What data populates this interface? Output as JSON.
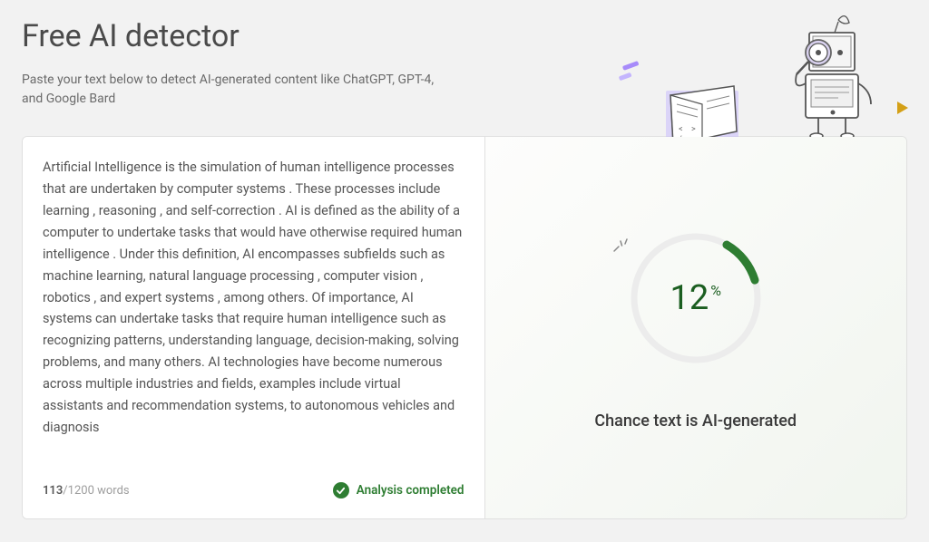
{
  "header": {
    "title": "Free AI detector",
    "subtitle": "Paste your text below to detect AI-generated content like ChatGPT, GPT-4, and Google Bard"
  },
  "input": {
    "text": "Artificial Intelligence is the simulation of human intelligence processes that are undertaken by computer systems . These processes include learning , reasoning , and self-correction . AI is defined as the ability of a computer to undertake tasks that would have otherwise required human intelligence . Under this definition, AI encompasses subfields such as machine learning, natural language processing , computer vision , robotics , and expert systems , among others. Of importance, AI systems can undertake tasks that require human intelligence such as recognizing patterns, understanding language, decision-making, solving problems, and many others. AI technologies have become numerous across multiple industries and fields, examples include virtual assistants and recommendation systems, to autonomous vehicles and diagnosis",
    "word_count_current": "113",
    "word_count_separator": "/",
    "word_count_max": "1200 words"
  },
  "status": {
    "label": "Analysis completed"
  },
  "result": {
    "percent": "12",
    "percent_symbol": "%",
    "label": "Chance text is AI-generated"
  },
  "chart_data": {
    "type": "gauge",
    "value": 12,
    "max": 100,
    "label": "Chance text is AI-generated",
    "unit": "%",
    "color_arc": "#2e7d32",
    "color_track": "#e8e8e8"
  }
}
